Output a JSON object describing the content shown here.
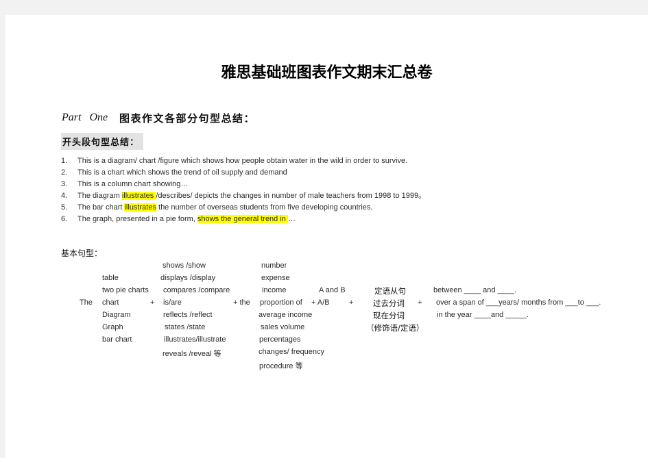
{
  "document": {
    "title": "雅思基础班图表作文期末汇总卷",
    "part": {
      "label": "Part One",
      "heading": "图表作文各部分句型总结："
    },
    "opening_section": {
      "heading": "开头段句型总结：",
      "items": [
        {
          "number": "1.",
          "parts": [
            {
              "text": "This is a diagram/ chart /figure which shows how people obtain water in the wild in order to survive.",
              "highlight": false
            }
          ]
        },
        {
          "number": "2.",
          "parts": [
            {
              "text": "This is a chart which shows the trend of oil supply and demand",
              "highlight": false
            }
          ]
        },
        {
          "number": "3.",
          "parts": [
            {
              "text": "This is a column chart showing…",
              "highlight": false
            }
          ]
        },
        {
          "number": "4.",
          "parts": [
            {
              "text": "The diagram ",
              "highlight": false
            },
            {
              "text": "illustrates ",
              "highlight": true
            },
            {
              "text": "/describes/ depicts the changes in number of male teachers from 1998 to 1999。",
              "highlight": false
            }
          ]
        },
        {
          "number": "5.",
          "parts": [
            {
              "text": "The bar chart ",
              "highlight": false
            },
            {
              "text": "illustrates",
              "highlight": true
            },
            {
              "text": " the number of overseas students from five developing countries.",
              "highlight": false
            }
          ]
        },
        {
          "number": "6.",
          "parts": [
            {
              "text": "The graph, presented in a pie form, ",
              "highlight": false
            },
            {
              "text": "shows the general trend in ",
              "highlight": true
            },
            {
              "text": "…",
              "highlight": false
            }
          ]
        }
      ]
    },
    "basic_patterns": {
      "label": "基本句型：",
      "the": "The",
      "plus1": "+",
      "plus_the": "+ the",
      "plus_ab": "+ A/B",
      "plus3": "+",
      "plus4": "+",
      "a_and_b": "A and B",
      "subjects": [
        "table",
        "two pie charts",
        "chart",
        "Diagram",
        "Graph",
        "bar chart"
      ],
      "verbs": [
        "shows /show",
        "displays /display",
        "compares /compare",
        "is/are",
        "reflects /reflect",
        "states /state",
        "illustrates/illustrate",
        "reveals /reveal  等"
      ],
      "objects": [
        "number",
        "expense",
        "income",
        "proportion of",
        "average income",
        "sales volume",
        "percentages",
        "changes/ frequency",
        "procedure  等"
      ],
      "modifiers": [
        "定语从句",
        "过去分词",
        "现在分词",
        "（修饰语/定语）"
      ],
      "time_phrases": [
        "between ____ and ____.",
        "over a span of ___years/ months from ___to ___.",
        "in the year ____and _____."
      ]
    },
    "colors": {
      "highlight": "#ffff00",
      "heading_bg": "#e3e3e3",
      "page_bg": "#ffffff",
      "outer_bg": "#f2f2f2"
    }
  }
}
